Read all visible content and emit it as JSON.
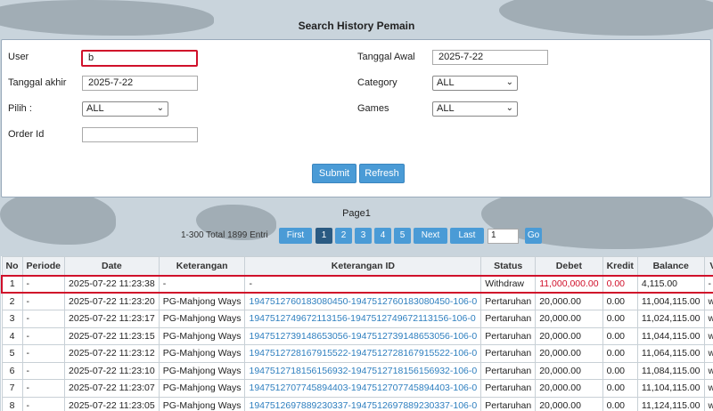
{
  "title": "Search History Pemain",
  "form": {
    "user_label": "User",
    "user_value": "b",
    "tanggal_awal_label": "Tanggal Awal",
    "tanggal_awal_value": "2025-7-22",
    "tanggal_akhir_label": "Tanggal akhir",
    "tanggal_akhir_value": "2025-7-22",
    "category_label": "Category",
    "category_value": "ALL",
    "pilih_label": "Pilih  :",
    "pilih_value": "ALL",
    "games_label": "Games",
    "games_value": "ALL",
    "order_id_label": "Order Id",
    "order_id_value": "",
    "submit_label": "Submit",
    "refresh_label": "Refresh"
  },
  "pagination": {
    "page_label": "Page1",
    "total_text": "1-300 Total 1899 Entri",
    "first": "First",
    "pages": [
      "1",
      "2",
      "3",
      "4",
      "5"
    ],
    "next": "Next",
    "last": "Last",
    "page_input": "1",
    "go": "Go"
  },
  "table": {
    "headers": [
      "No",
      "Periode",
      "Date",
      "Keterangan",
      "Keterangan ID",
      "Status",
      "Debet",
      "Kredit",
      "Balance",
      "Via"
    ],
    "rows": [
      {
        "no": "1",
        "periode": "-",
        "date": "2025-07-22 11:23:38",
        "ket": "-",
        "ket_id": "-",
        "status": "Withdraw",
        "debet": "11,000,000.00",
        "kredit": "0.00",
        "balance": "4,115.00",
        "via": "-"
      },
      {
        "no": "2",
        "periode": "-",
        "date": "2025-07-22 11:23:20",
        "ket": "PG-Mahjong Ways",
        "ket_id": "1947512760183080450-1947512760183080450-106-0",
        "status": "Pertaruhan",
        "debet": "20,000.00",
        "kredit": "0.00",
        "balance": "11,004,115.00",
        "via": "web"
      },
      {
        "no": "3",
        "periode": "-",
        "date": "2025-07-22 11:23:17",
        "ket": "PG-Mahjong Ways",
        "ket_id": "1947512749672113156-1947512749672113156-106-0",
        "status": "Pertaruhan",
        "debet": "20,000.00",
        "kredit": "0.00",
        "balance": "11,024,115.00",
        "via": "web"
      },
      {
        "no": "4",
        "periode": "-",
        "date": "2025-07-22 11:23:15",
        "ket": "PG-Mahjong Ways",
        "ket_id": "1947512739148653056-1947512739148653056-106-0",
        "status": "Pertaruhan",
        "debet": "20,000.00",
        "kredit": "0.00",
        "balance": "11,044,115.00",
        "via": "web"
      },
      {
        "no": "5",
        "periode": "-",
        "date": "2025-07-22 11:23:12",
        "ket": "PG-Mahjong Ways",
        "ket_id": "1947512728167915522-1947512728167915522-106-0",
        "status": "Pertaruhan",
        "debet": "20,000.00",
        "kredit": "0.00",
        "balance": "11,064,115.00",
        "via": "web"
      },
      {
        "no": "6",
        "periode": "-",
        "date": "2025-07-22 11:23:10",
        "ket": "PG-Mahjong Ways",
        "ket_id": "1947512718156156932-1947512718156156932-106-0",
        "status": "Pertaruhan",
        "debet": "20,000.00",
        "kredit": "0.00",
        "balance": "11,084,115.00",
        "via": "web"
      },
      {
        "no": "7",
        "periode": "-",
        "date": "2025-07-22 11:23:07",
        "ket": "PG-Mahjong Ways",
        "ket_id": "1947512707745894403-1947512707745894403-106-0",
        "status": "Pertaruhan",
        "debet": "20,000.00",
        "kredit": "0.00",
        "balance": "11,104,115.00",
        "via": "web"
      },
      {
        "no": "8",
        "periode": "-",
        "date": "2025-07-22 11:23:05",
        "ket": "PG-Mahjong Ways",
        "ket_id": "1947512697889230337-1947512697889230337-106-0",
        "status": "Pertaruhan",
        "debet": "20,000.00",
        "kredit": "0.00",
        "balance": "11,124,115.00",
        "via": "web"
      }
    ]
  },
  "colors": {
    "accent": "#4a9bd6",
    "highlight": "#d0102a",
    "link": "#2e7fbf"
  },
  "icons": {
    "select_arrow": "chevron-down-icon"
  }
}
